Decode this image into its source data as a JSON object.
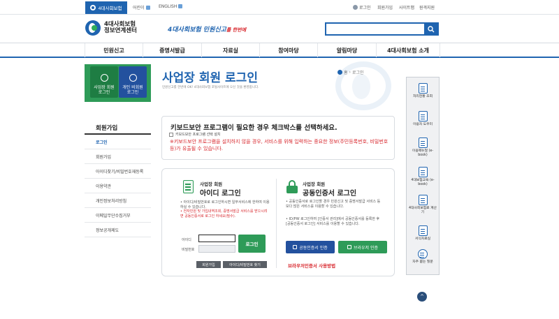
{
  "topbar": {
    "brand_tab": "4대사회보험",
    "lang_kids": "어린이",
    "lang_english": "ENGLISH",
    "util": [
      "로그인",
      "회원가입",
      "사이트맵",
      "원격지원"
    ]
  },
  "header": {
    "logo_line1": "4대사회보험",
    "logo_line2": "정보연계센터",
    "slogan_main": "4대사회보험 민원신고",
    "slogan_tail": "를 한번에",
    "search_placeholder": ""
  },
  "gnb": [
    "민원신고",
    "증명서발급",
    "자료실",
    "참여마당",
    "알림마당",
    "4대사회보험 소개"
  ],
  "sidebar": {
    "quick_biz": [
      "사업장 회원",
      "로그인"
    ],
    "quick_personal": [
      "개인 비회원",
      "로그인"
    ],
    "title": "회원가입",
    "items": [
      {
        "label": "로그인",
        "active": true
      },
      {
        "label": "회원가입",
        "active": false
      },
      {
        "label": "아이디찾기/비밀번호재등록",
        "active": false
      },
      {
        "label": "이용약관",
        "active": false
      },
      {
        "label": "개인정보처리방침",
        "active": false
      },
      {
        "label": "이메일무단수집거부",
        "active": false
      },
      {
        "label": "정보공개제도",
        "active": false
      }
    ]
  },
  "main": {
    "title": "사업장 회원 로그인",
    "description": "민원신고를 한번에 OK! 4대사회보험 포털사이트에 오신 것을 환영합니다.",
    "breadcrumb": [
      "홈",
      "로그인"
    ],
    "keyboard_box": {
      "heading": "키보드보안 프로그램이 필요한 경우 체크박스를 선택하세요.",
      "checkbox_label": "키보드보안 프로그램 선택 설치",
      "warning": "※키보드보안 프로그램을 설치하지 않을 경우, 서비스를 위해 입력하는 중요한 정보(주민등록번호, 비밀번호 등)가 유출될 수 있습니다."
    },
    "id_login": {
      "sub": "사업장 회원",
      "title": "아이디 로그인",
      "desc_normal": "• 아이디/비밀번호로 로그인하시면 일부서비스에 한하여 이용하실 수 있습니다.",
      "desc_red": "• 전자민원 및 가입내역조회, 증명서발급 서비스를 받으시려면 공동인증서로 로그인 하세요(필수).",
      "id_label": "아이디",
      "pw_label": "비밀번호",
      "id_value": "",
      "pw_value": "",
      "login_button": "로그인",
      "join_button": "회원가입",
      "find_button": "아이디/비밀번호 찾기"
    },
    "cert_login": {
      "sub": "사업장 회원",
      "title": "공동인증서 로그인",
      "desc1": "• 공동인증서로 로그인할 경우 민원신고 및 증명서발급 서비스 등 보다 많은 서비스를 이용할 수 있습니다.",
      "desc2": "• ID/PW 로그인하여 [인증서 관리]에서 공동인증서를 등록한 후 [공동인증서 로그인] 서비스를 이용할 수 있습니다.",
      "cert_button": "공동인증서 인증",
      "browser_button": "브라우저 인증",
      "browser_method": "브라우저인증서 사용방법"
    }
  },
  "quick_menu": [
    "처리현황 조회",
    "이용자 도우미",
    "이용매뉴얼 (e-book)",
    "4대보험교육 (e-book)",
    "4대사회보험료 계산기",
    "서식자료실",
    "자주 묻는 질문"
  ],
  "top_button": "^"
}
